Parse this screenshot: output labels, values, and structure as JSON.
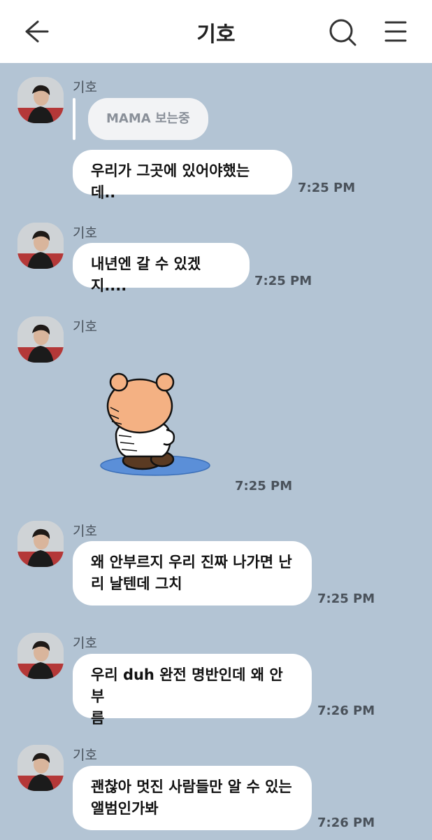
{
  "header": {
    "title": "기호",
    "back_icon": "arrow-left-icon",
    "search_icon": "search-icon",
    "menu_icon": "hamburger-menu-icon"
  },
  "messages": [
    {
      "sender": "기호",
      "quote": "MAMA 보는중",
      "text": "우리가 그곳에 있어야했는데..",
      "time": "7:25 PM"
    },
    {
      "sender": "기호",
      "text": "내년엔 갈 수 있겠지....",
      "time": "7:25 PM"
    },
    {
      "sender": "기호",
      "sticker": "sad-bear-sticker",
      "time": "7:25 PM"
    },
    {
      "sender": "기호",
      "text": "왜 안부르지 우리 진짜 나가면 난\n리 날텐데 그치",
      "time": "7:25 PM"
    },
    {
      "sender": "기호",
      "text": "우리 duh 완전 명반인데 왜 안부\n름",
      "time": "7:26 PM"
    },
    {
      "sender": "기호",
      "text": "괜찮아 멋진 사람들만 알 수 있는\n앨범인가봐",
      "time": "7:26 PM"
    }
  ],
  "colors": {
    "background": "#b3c4d4",
    "bubble": "#ffffff",
    "header": "#ffffff"
  }
}
